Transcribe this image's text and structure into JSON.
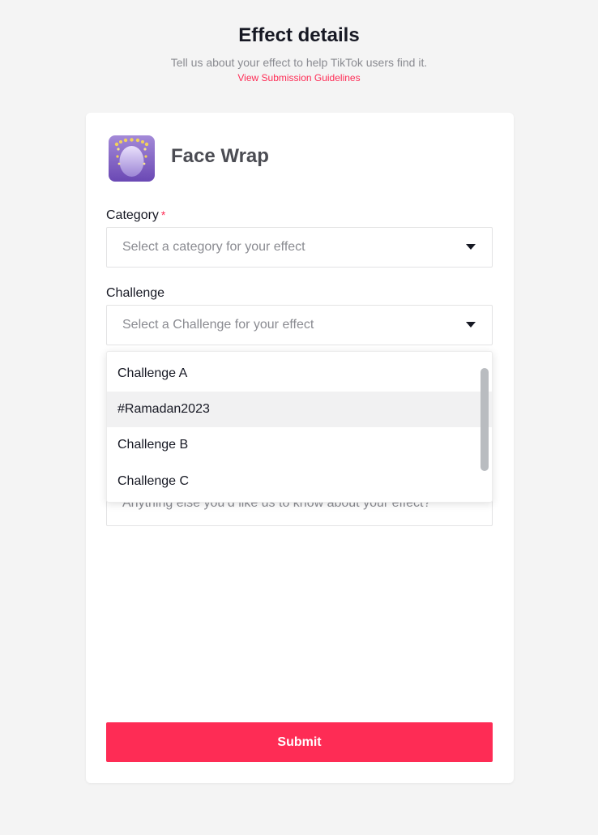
{
  "header": {
    "title": "Effect details",
    "subtitle": "Tell us about your effect to help TikTok users find it.",
    "guidelines_link": "View Submission Guidelines"
  },
  "effect": {
    "name": "Face Wrap",
    "thumbnail_icon": "face-wrap-effect-thumbnail"
  },
  "category": {
    "label": "Category",
    "required_mark": "*",
    "placeholder": "Select a category for your effect"
  },
  "challenge": {
    "label": "Challenge",
    "placeholder": "Select a Challenge for your effect",
    "options": [
      {
        "label": "Challenge A"
      },
      {
        "label": "#Ramadan2023"
      },
      {
        "label": "Challenge B"
      },
      {
        "label": "Challenge C"
      }
    ]
  },
  "notes": {
    "placeholder": "Anything else you’d like us to know about your effect?"
  },
  "submit": {
    "label": "Submit"
  },
  "colors": {
    "accent": "#fe2c55",
    "background": "#f4f4f4",
    "card": "#ffffff",
    "text": "#161823",
    "placeholder": "#8a8b91",
    "hover_row": "#f1f1f2"
  }
}
